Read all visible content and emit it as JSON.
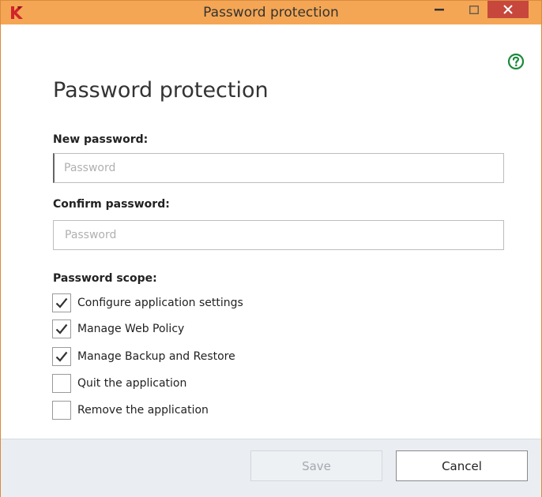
{
  "window": {
    "title": "Password protection",
    "accent_color": "#f4a654",
    "close_color": "#c7473d"
  },
  "page": {
    "heading": "Password protection"
  },
  "form": {
    "new_password_label": "New password:",
    "new_password_placeholder": "Password",
    "new_password_value": "",
    "confirm_password_label": "Confirm password:",
    "confirm_password_placeholder": "Password",
    "confirm_password_value": "",
    "scope_label": "Password scope:",
    "scope_items": [
      {
        "label": "Configure application settings",
        "checked": true
      },
      {
        "label": "Manage Web Policy",
        "checked": true
      },
      {
        "label": "Manage Backup and Restore",
        "checked": true
      },
      {
        "label": "Quit the application",
        "checked": false
      },
      {
        "label": "Remove the application",
        "checked": false
      }
    ]
  },
  "footer": {
    "save_label": "Save",
    "save_enabled": false,
    "cancel_label": "Cancel"
  },
  "icons": {
    "app": "kaspersky-logo-icon",
    "help": "help-circle-icon",
    "minimize": "minimize-icon",
    "maximize": "maximize-icon",
    "close": "close-icon",
    "check": "checkmark-icon"
  }
}
